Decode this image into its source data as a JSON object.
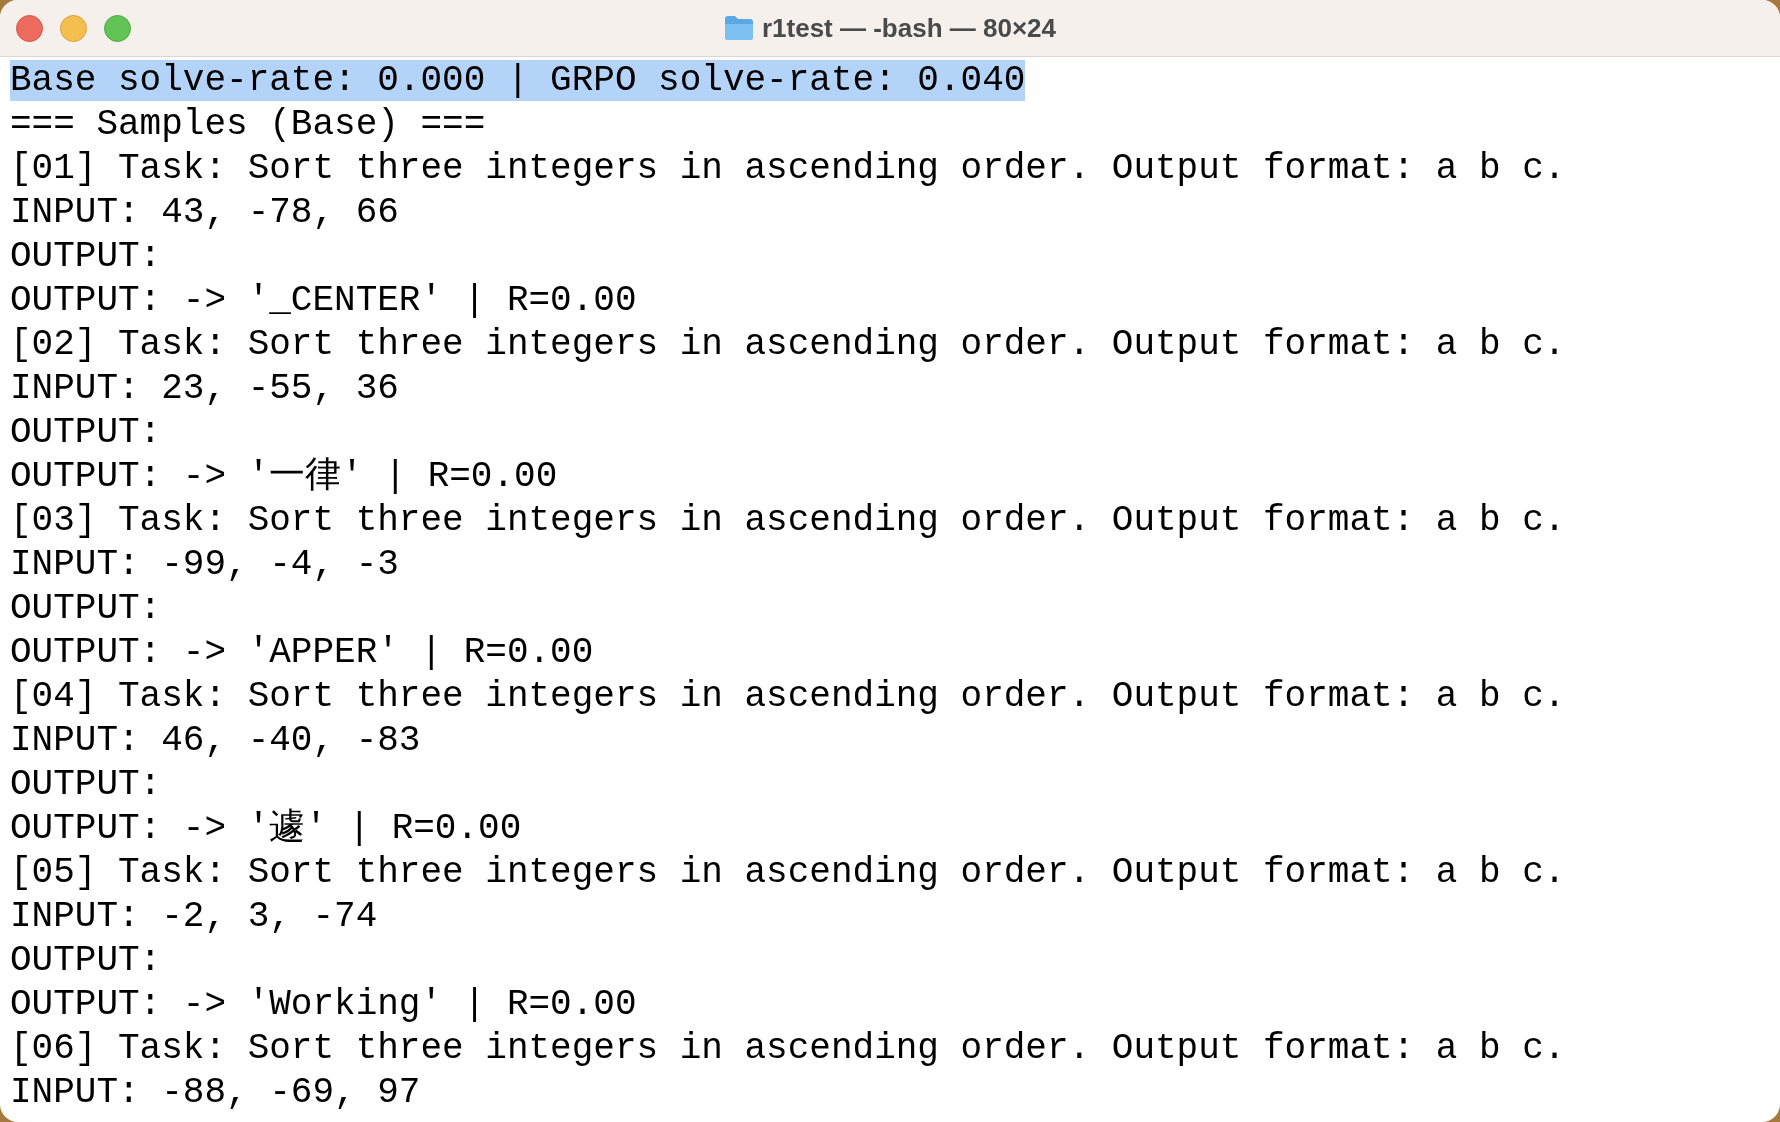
{
  "window": {
    "title": "r1test — -bash — 80×24"
  },
  "lines": [
    {
      "text": "Base solve-rate: 0.000 | GRPO solve-rate: 0.040",
      "selected": true
    },
    {
      "text": "=== Samples (Base) ===",
      "selected": false
    },
    {
      "text": "[01] Task: Sort three integers in ascending order. Output format: a b c.",
      "selected": false
    },
    {
      "text": "INPUT: 43, -78, 66",
      "selected": false
    },
    {
      "text": "OUTPUT:",
      "selected": false
    },
    {
      "text": "OUTPUT: -> '_CENTER' | R=0.00",
      "selected": false
    },
    {
      "text": "[02] Task: Sort three integers in ascending order. Output format: a b c.",
      "selected": false
    },
    {
      "text": "INPUT: 23, -55, 36",
      "selected": false
    },
    {
      "text": "OUTPUT:",
      "selected": false
    },
    {
      "text": "OUTPUT: -> '一律' | R=0.00",
      "selected": false
    },
    {
      "text": "[03] Task: Sort three integers in ascending order. Output format: a b c.",
      "selected": false
    },
    {
      "text": "INPUT: -99, -4, -3",
      "selected": false
    },
    {
      "text": "OUTPUT:",
      "selected": false
    },
    {
      "text": "OUTPUT: -> 'APPER' | R=0.00",
      "selected": false
    },
    {
      "text": "[04] Task: Sort three integers in ascending order. Output format: a b c.",
      "selected": false
    },
    {
      "text": "INPUT: 46, -40, -83",
      "selected": false
    },
    {
      "text": "OUTPUT:",
      "selected": false
    },
    {
      "text": "OUTPUT: -> '遽' | R=0.00",
      "selected": false
    },
    {
      "text": "[05] Task: Sort three integers in ascending order. Output format: a b c.",
      "selected": false
    },
    {
      "text": "INPUT: -2, 3, -74",
      "selected": false
    },
    {
      "text": "OUTPUT:",
      "selected": false
    },
    {
      "text": "OUTPUT: -> 'Working' | R=0.00",
      "selected": false
    },
    {
      "text": "[06] Task: Sort three integers in ascending order. Output format: a b c.",
      "selected": false
    },
    {
      "text": "INPUT: -88, -69, 97",
      "selected": false
    }
  ]
}
